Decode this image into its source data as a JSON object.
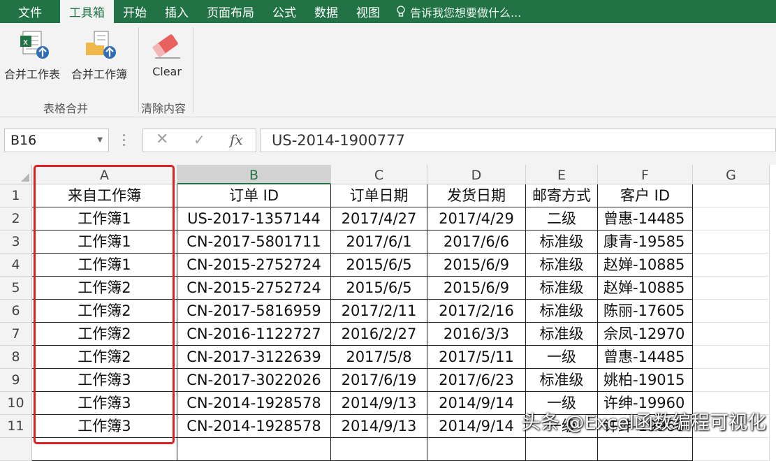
{
  "ribbon": {
    "tabs": [
      "文件",
      "工具箱",
      "开始",
      "插入",
      "页面布局",
      "公式",
      "数据",
      "视图"
    ],
    "active_tab": "工具箱",
    "tell_me": "告诉我您想要做什么...",
    "buttons": {
      "merge_sheets": "合并工作表",
      "merge_books": "合并工作簿",
      "clear": "Clear"
    },
    "groups": {
      "merge": "表格合并",
      "clear": "清除内容"
    },
    "colors": {
      "accent": "#217346",
      "eraser": "#e8605f"
    }
  },
  "formula_bar": {
    "name_box": "B16",
    "formula": "US-2014-1900777",
    "fx_label": "fx"
  },
  "sheet": {
    "columns": [
      "A",
      "B",
      "C",
      "D",
      "E",
      "F",
      "G"
    ],
    "selected_column": "B",
    "header_row": [
      "来自工作簿",
      "订单 ID",
      "订单日期",
      "发货日期",
      "邮寄方式",
      "客户 ID"
    ],
    "rows": [
      [
        "工作簿1",
        "US-2017-1357144",
        "2017/4/27",
        "2017/4/29",
        "二级",
        "曾惠-14485"
      ],
      [
        "工作簿1",
        "CN-2017-5801711",
        "2017/6/1",
        "2017/6/6",
        "标准级",
        "康青-19585"
      ],
      [
        "工作簿1",
        "CN-2015-2752724",
        "2015/6/5",
        "2015/6/9",
        "标准级",
        "赵婵-10885"
      ],
      [
        "工作簿2",
        "CN-2015-2752724",
        "2015/6/5",
        "2015/6/9",
        "标准级",
        "赵婵-10885"
      ],
      [
        "工作簿2",
        "CN-2017-5816959",
        "2017/2/11",
        "2017/2/16",
        "标准级",
        "陈丽-17605"
      ],
      [
        "工作簿2",
        "CN-2016-1122727",
        "2016/2/27",
        "2016/3/3",
        "标准级",
        "佘凤-12970"
      ],
      [
        "工作簿2",
        "CN-2017-3122639",
        "2017/5/8",
        "2017/5/11",
        "一级",
        "曾惠-14485"
      ],
      [
        "工作簿3",
        "CN-2017-3022026",
        "2017/6/19",
        "2017/6/23",
        "标准级",
        "姚柏-19015"
      ],
      [
        "工作簿3",
        "CN-2014-1928578",
        "2014/9/13",
        "2014/9/14",
        "一级",
        "许绅-19960"
      ],
      [
        "工作簿3",
        "CN-2014-1928578",
        "2014/9/13",
        "2014/9/14",
        "一级",
        "许绅-19960"
      ]
    ],
    "row_numbers": [
      "1",
      "2",
      "3",
      "4",
      "5",
      "6",
      "7",
      "8",
      "9",
      "10",
      "11"
    ],
    "highlight_color": "#e02020"
  },
  "watermark": "头条 @Excel函数编程可视化"
}
